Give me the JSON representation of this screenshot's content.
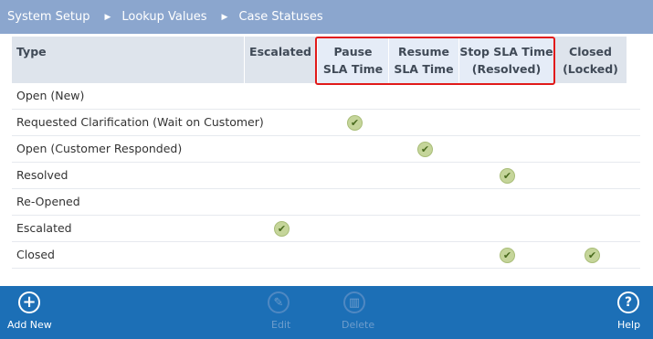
{
  "breadcrumb": {
    "items": [
      "System Setup",
      "Lookup Values",
      "Case Statuses"
    ],
    "separator": "▶"
  },
  "table": {
    "columns": [
      {
        "line1": "Type",
        "line2": ""
      },
      {
        "line1": "Escalated",
        "line2": ""
      },
      {
        "line1": "Pause",
        "line2": "SLA Time"
      },
      {
        "line1": "Resume",
        "line2": "SLA Time"
      },
      {
        "line1": "Stop SLA Time",
        "line2": "(Resolved)"
      },
      {
        "line1": "Closed",
        "line2": "(Locked)"
      }
    ],
    "rows": [
      {
        "label": "Open (New)",
        "escalated": false,
        "pause": false,
        "resume": false,
        "stop": false,
        "closed": false
      },
      {
        "label": "Requested Clarification (Wait on Customer)",
        "escalated": false,
        "pause": true,
        "resume": false,
        "stop": false,
        "closed": false
      },
      {
        "label": "Open (Customer Responded)",
        "escalated": false,
        "pause": false,
        "resume": true,
        "stop": false,
        "closed": false
      },
      {
        "label": "Resolved",
        "escalated": false,
        "pause": false,
        "resume": false,
        "stop": true,
        "closed": false
      },
      {
        "label": "Re-Opened",
        "escalated": false,
        "pause": false,
        "resume": false,
        "stop": false,
        "closed": false
      },
      {
        "label": "Escalated",
        "escalated": true,
        "pause": false,
        "resume": false,
        "stop": false,
        "closed": false
      },
      {
        "label": "Closed",
        "escalated": false,
        "pause": false,
        "resume": false,
        "stop": true,
        "closed": true
      }
    ],
    "check_icon": "check-circle-icon"
  },
  "highlight": {
    "color": "#e11a1a"
  },
  "footer": {
    "add_new": {
      "label": "Add New",
      "icon": "plus-circle-icon",
      "enabled": true
    },
    "edit": {
      "label": "Edit",
      "icon": "pencil-icon",
      "enabled": false
    },
    "delete": {
      "label": "Delete",
      "icon": "trash-icon",
      "enabled": false
    },
    "help": {
      "label": "Help",
      "icon": "question-circle-icon",
      "enabled": true
    }
  },
  "colors": {
    "header_bar": "#8ba6ce",
    "footer_bar": "#1c6fb6",
    "column_header": "#dee4ec",
    "check": "#c5d59a"
  }
}
